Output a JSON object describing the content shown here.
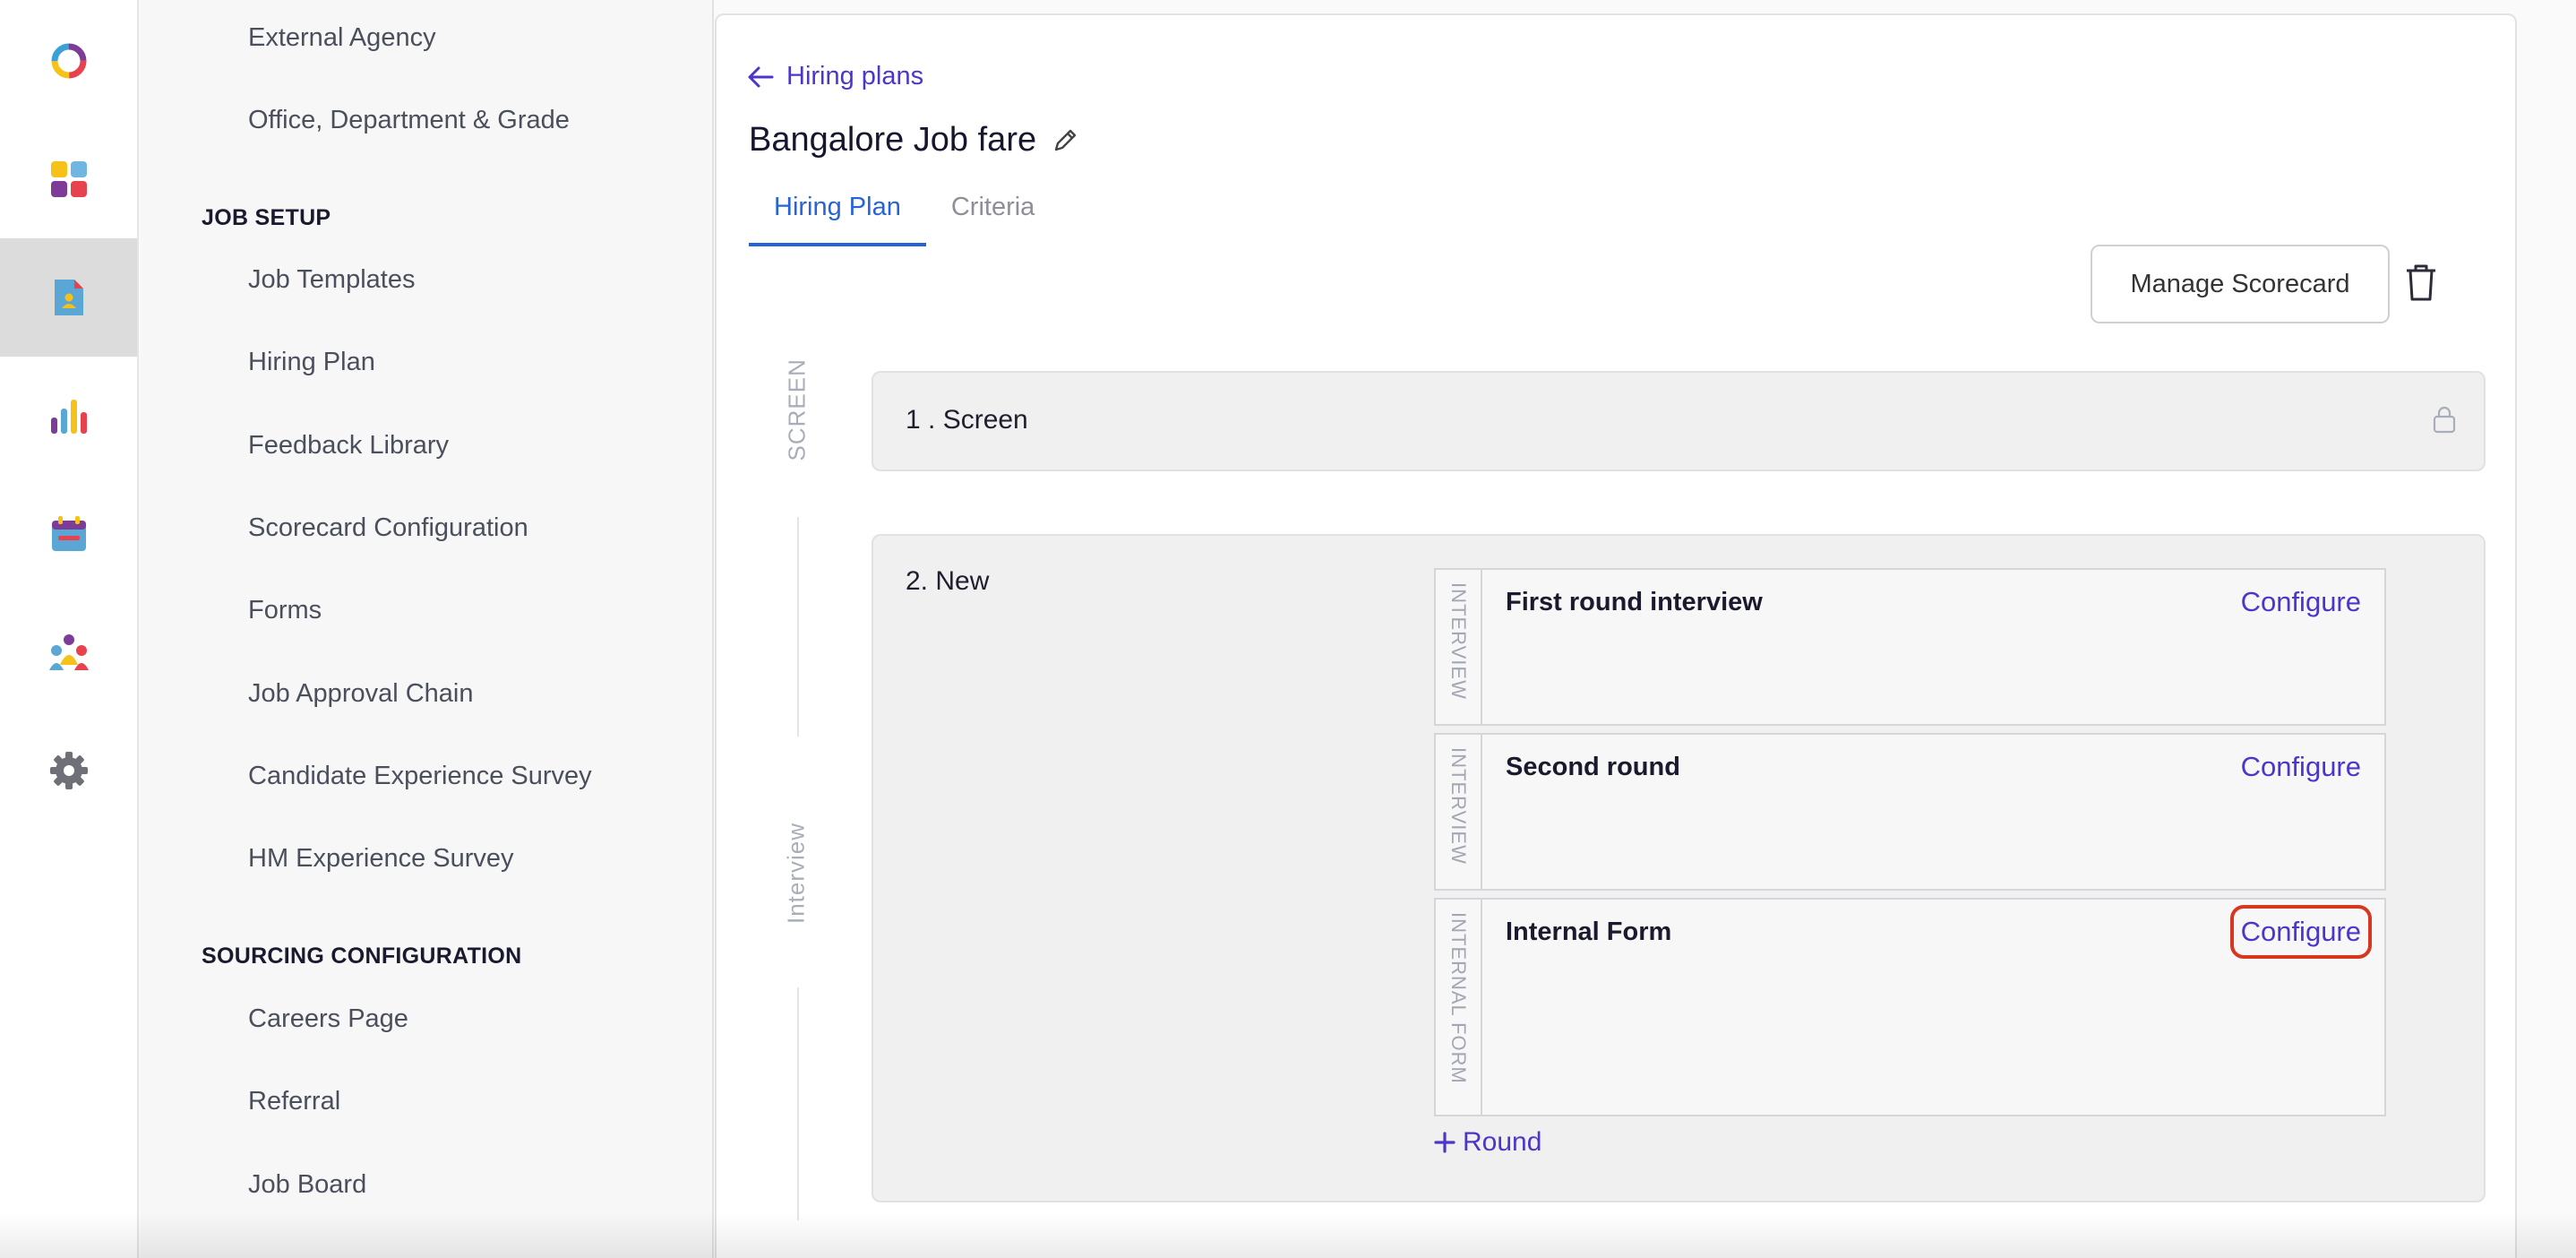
{
  "rail": {
    "items": [
      {
        "icon": "app-logo-icon"
      },
      {
        "icon": "dashboard-icon"
      },
      {
        "icon": "jobs-icon",
        "active": true
      },
      {
        "icon": "reports-icon"
      },
      {
        "icon": "calendar-icon"
      },
      {
        "icon": "people-icon"
      },
      {
        "icon": "settings-gear-icon"
      }
    ]
  },
  "menu": {
    "top_items": [
      "External Agency",
      "Office, Department & Grade"
    ],
    "job_setup": {
      "heading": "JOB SETUP",
      "items": [
        "Job Templates",
        "Hiring Plan",
        "Feedback Library",
        "Scorecard Configuration",
        "Forms",
        "Job Approval Chain",
        "Candidate Experience Survey",
        "HM Experience Survey"
      ]
    },
    "sourcing": {
      "heading": "SOURCING CONFIGURATION",
      "items": [
        "Careers Page",
        "Referral",
        "Job Board"
      ]
    }
  },
  "main": {
    "back_label": "Hiring plans",
    "title": "Bangalore Job fare",
    "tabs": [
      {
        "label": "Hiring Plan",
        "active": true
      },
      {
        "label": "Criteria",
        "active": false
      }
    ],
    "manage_scorecard_label": "Manage Scorecard",
    "stage_labels": {
      "screen": "SCREEN",
      "interview": "Interview"
    },
    "stages": [
      {
        "title": "1 . Screen",
        "locked": true
      },
      {
        "title": "2. New",
        "rounds": [
          {
            "type": "INTERVIEW",
            "name": "First round interview",
            "action": "Configure"
          },
          {
            "type": "INTERVIEW",
            "name": "Second round",
            "action": "Configure"
          },
          {
            "type": "INTERNAL FORM",
            "name": "Internal Form",
            "action": "Configure",
            "highlighted": true
          }
        ],
        "add_round_label": "Round"
      }
    ]
  },
  "colors": {
    "accent": "#4b36c9",
    "tab_active": "#2464d6",
    "highlight": "#d8371f"
  }
}
